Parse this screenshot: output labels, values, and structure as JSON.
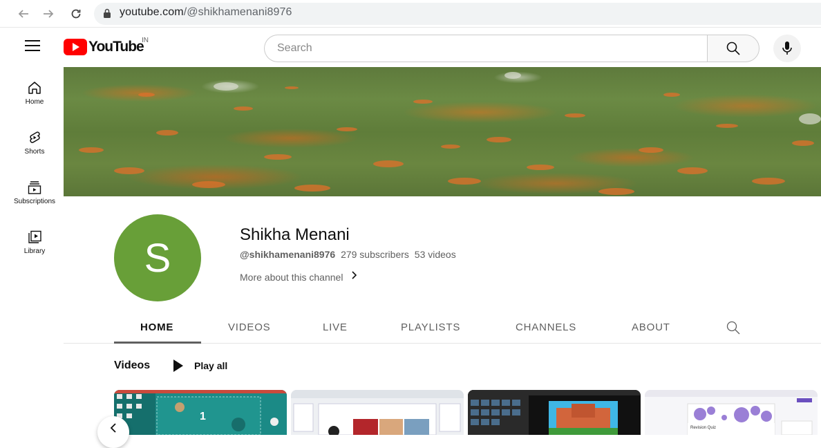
{
  "browser": {
    "url_host": "youtube.com",
    "url_path": "/@shikhamenani8976"
  },
  "header": {
    "logo_text": "YouTube",
    "country_code": "IN",
    "search_placeholder": "Search"
  },
  "sidebar": {
    "items": [
      {
        "label": "Home",
        "icon": "home-icon"
      },
      {
        "label": "Shorts",
        "icon": "shorts-icon"
      },
      {
        "label": "Subscriptions",
        "icon": "subscriptions-icon"
      },
      {
        "label": "Library",
        "icon": "library-icon"
      }
    ]
  },
  "channel": {
    "avatar_letter": "S",
    "avatar_color": "#689f38",
    "name": "Shikha Menani",
    "handle": "@shikhamenani8976",
    "subscribers": "279 subscribers",
    "videos": "53 videos",
    "more_about": "More about this channel"
  },
  "tabs": [
    {
      "label": "HOME",
      "active": true
    },
    {
      "label": "VIDEOS",
      "active": false
    },
    {
      "label": "LIVE",
      "active": false
    },
    {
      "label": "PLAYLISTS",
      "active": false
    },
    {
      "label": "CHANNELS",
      "active": false
    },
    {
      "label": "ABOUT",
      "active": false
    }
  ],
  "shelf": {
    "title": "Videos",
    "play_all": "Play all",
    "thumb1_number": "1",
    "thumb4_heading": "Revision Quiz"
  },
  "colors": {
    "brand_red": "#ff0000",
    "text_primary": "#0f0f0f",
    "text_secondary": "#606060"
  }
}
